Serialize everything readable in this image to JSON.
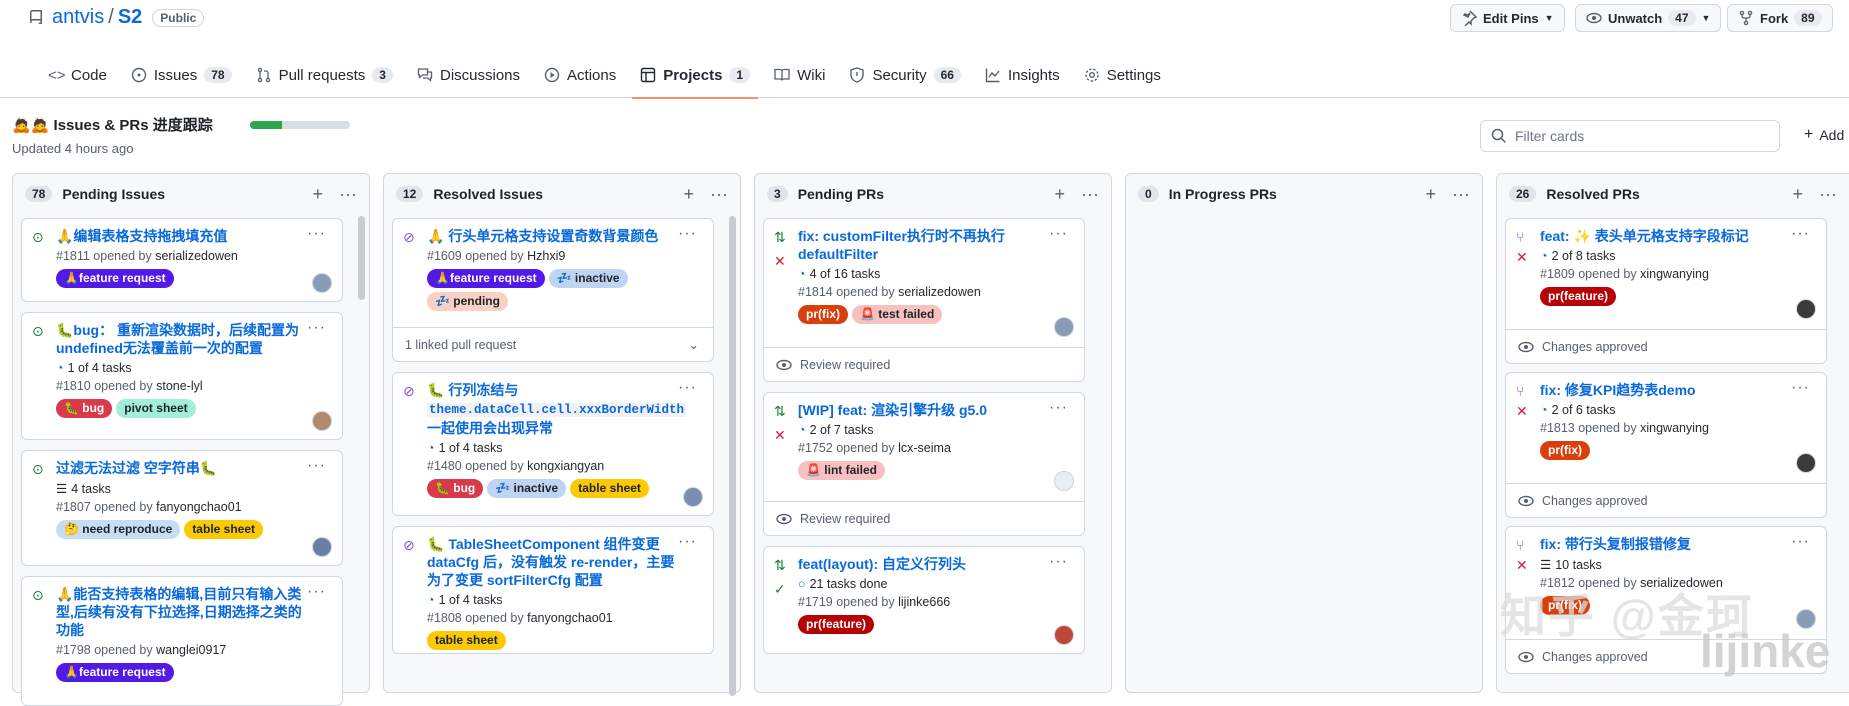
{
  "repo": {
    "owner": "antvis",
    "name": "S2",
    "visibility": "Public"
  },
  "header_buttons": {
    "edit_pins": "Edit Pins",
    "unwatch": "Unwatch",
    "unwatch_count": "47",
    "fork": "Fork",
    "fork_count": "89"
  },
  "tabs": [
    {
      "label": "Code",
      "icon": "code-icon",
      "count": ""
    },
    {
      "label": "Issues",
      "icon": "issue-icon",
      "count": "78"
    },
    {
      "label": "Pull requests",
      "icon": "pull-request-icon",
      "count": "3"
    },
    {
      "label": "Discussions",
      "icon": "discussion-icon",
      "count": ""
    },
    {
      "label": "Actions",
      "icon": "play-icon",
      "count": ""
    },
    {
      "label": "Projects",
      "icon": "table-icon",
      "count": "1",
      "active": true
    },
    {
      "label": "Wiki",
      "icon": "book-icon",
      "count": ""
    },
    {
      "label": "Security",
      "icon": "shield-icon",
      "count": "66"
    },
    {
      "label": "Insights",
      "icon": "graph-icon",
      "count": ""
    },
    {
      "label": "Settings",
      "icon": "gear-icon",
      "count": ""
    }
  ],
  "project": {
    "title": "🙇🙇 Issues & PRs 进度跟踪",
    "updated": "Updated 4 hours ago",
    "progress": 0.32,
    "filter_placeholder": "Filter cards",
    "add_label": "Add"
  },
  "columns": [
    {
      "count": "78",
      "name": "Pending Issues",
      "cards": [
        {
          "title": "🙏编辑表格支持拖拽填充值",
          "meta_prefix": "#1811 opened by",
          "author": "serializedowen",
          "labels": [
            {
              "text": "🙏feature request",
              "bg": "#5319e7",
              "fg": "#ffffff"
            }
          ]
        },
        {
          "title": "🐛bug： 重新渲染数据时，后续配置为undefined无法覆盖前一次的配置",
          "tasks": "1 of 4 tasks",
          "meta_prefix": "#1810 opened by",
          "author": "stone-lyl",
          "labels": [
            {
              "text": "🐛 bug",
              "bg": "#d73a4a",
              "fg": "#ffffff"
            },
            {
              "text": "pivot sheet",
              "bg": "#a2eeda",
              "fg": "#1f2328"
            }
          ]
        },
        {
          "title": "过滤无法过滤 空字符串🐛",
          "tasks": "4 tasks",
          "meta_prefix": "#1807 opened by",
          "author": "fanyongchao01",
          "labels": [
            {
              "text": "🤔 need reproduce",
              "bg": "#c5def5",
              "fg": "#1f2328"
            },
            {
              "text": "table sheet",
              "bg": "#fbca04",
              "fg": "#1f2328"
            }
          ]
        },
        {
          "title": "🙏能否支持表格的编辑,目前只有输入类型,后续有没有下拉选择,日期选择之类的功能",
          "meta_prefix": "#1798 opened by",
          "author": "wanglei0917",
          "labels": [
            {
              "text": "🙏feature request",
              "bg": "#5319e7",
              "fg": "#ffffff"
            }
          ]
        }
      ]
    },
    {
      "count": "12",
      "name": "Resolved Issues",
      "cards": [
        {
          "title": "🙏 行头单元格支持设置奇数背景颜色",
          "meta_prefix": "#1609 opened by",
          "author": "Hzhxi9",
          "labels": [
            {
              "text": "🙏feature request",
              "bg": "#5319e7",
              "fg": "#ffffff"
            },
            {
              "text": "💤 inactive",
              "bg": "#bfd4f2",
              "fg": "#1f2328"
            },
            {
              "text": "💤 pending",
              "bg": "#f9d0c4",
              "fg": "#1f2328"
            }
          ],
          "linked": "1 linked pull request"
        },
        {
          "title_pre": "🐛 行列冻结与 ",
          "title_code": "theme.dataCell.cell.xxxBorderWidth",
          "title_post": " 一起使用会出现异常",
          "tasks": "1 of 4 tasks",
          "meta_prefix": "#1480 opened by",
          "author": "kongxiangyan",
          "labels": [
            {
              "text": "🐛 bug",
              "bg": "#d73a4a",
              "fg": "#ffffff"
            },
            {
              "text": "💤 inactive",
              "bg": "#bfd4f2",
              "fg": "#1f2328"
            },
            {
              "text": "table sheet",
              "bg": "#fbca04",
              "fg": "#1f2328"
            }
          ]
        },
        {
          "title": "🐛 TableSheetComponent 组件变更 dataCfg 后，没有触发 re-render，主要为了变更 sortFilterCfg 配置",
          "tasks": "1 of 4 tasks",
          "meta_prefix": "#1808 opened by",
          "author": "fanyongchao01",
          "labels": [
            {
              "text": "table sheet",
              "bg": "#fbca04",
              "fg": "#1f2328"
            }
          ]
        }
      ]
    },
    {
      "count": "3",
      "name": "Pending PRs",
      "cards": [
        {
          "title": "fix: customFilter执行时不再执行defaultFilter",
          "tasks": "4 of 16 tasks",
          "meta_prefix": "#1814 opened by",
          "author": "serializedowen",
          "labels": [
            {
              "text": "pr(fix)",
              "bg": "#d93f0b",
              "fg": "#ffffff"
            },
            {
              "text": "🚨 test failed",
              "bg": "#f9c0c0",
              "fg": "#1f2328"
            }
          ],
          "footer": "Review required"
        },
        {
          "title": "[WIP] feat: 渲染引擎升级 g5.0",
          "tasks": "2 of 7 tasks",
          "meta_prefix": "#1752 opened by",
          "author": "lcx-seima",
          "labels": [
            {
              "text": "🚨 lint failed",
              "bg": "#f9c0c0",
              "fg": "#1f2328"
            }
          ],
          "footer": "Review required"
        },
        {
          "title": "feat(layout): 自定义行列头",
          "tasks": "21 tasks done",
          "meta_prefix": "#1719 opened by",
          "author": "lijinke666",
          "labels": [
            {
              "text": "pr(feature)",
              "bg": "#b60205",
              "fg": "#ffffff"
            }
          ]
        }
      ]
    },
    {
      "count": "0",
      "name": "In Progress PRs",
      "cards": []
    },
    {
      "count": "26",
      "name": "Resolved PRs",
      "cards": [
        {
          "title": "feat: ✨ 表头单元格支持字段标记",
          "tasks": "2 of 8 tasks",
          "meta_prefix": "#1809 opened by",
          "author": "xingwanying",
          "labels": [
            {
              "text": "pr(feature)",
              "bg": "#b60205",
              "fg": "#ffffff"
            }
          ],
          "footer": "Changes approved"
        },
        {
          "title": "fix: 修复KPI趋势表demo",
          "tasks": "2 of 6 tasks",
          "meta_prefix": "#1813 opened by",
          "author": "xingwanying",
          "labels": [
            {
              "text": "pr(fix)",
              "bg": "#d93f0b",
              "fg": "#ffffff"
            }
          ],
          "footer": "Changes approved"
        },
        {
          "title": "fix: 带行头复制报错修复",
          "tasks": "10 tasks",
          "meta_prefix": "#1812 opened by",
          "author": "serializedowen",
          "labels": [
            {
              "text": "pr(fix)",
              "bg": "#d93f0b",
              "fg": "#ffffff"
            }
          ],
          "footer": "Changes approved"
        }
      ]
    }
  ],
  "watermark": {
    "line1": "知乎 @金珂",
    "line2": "lijinke"
  }
}
